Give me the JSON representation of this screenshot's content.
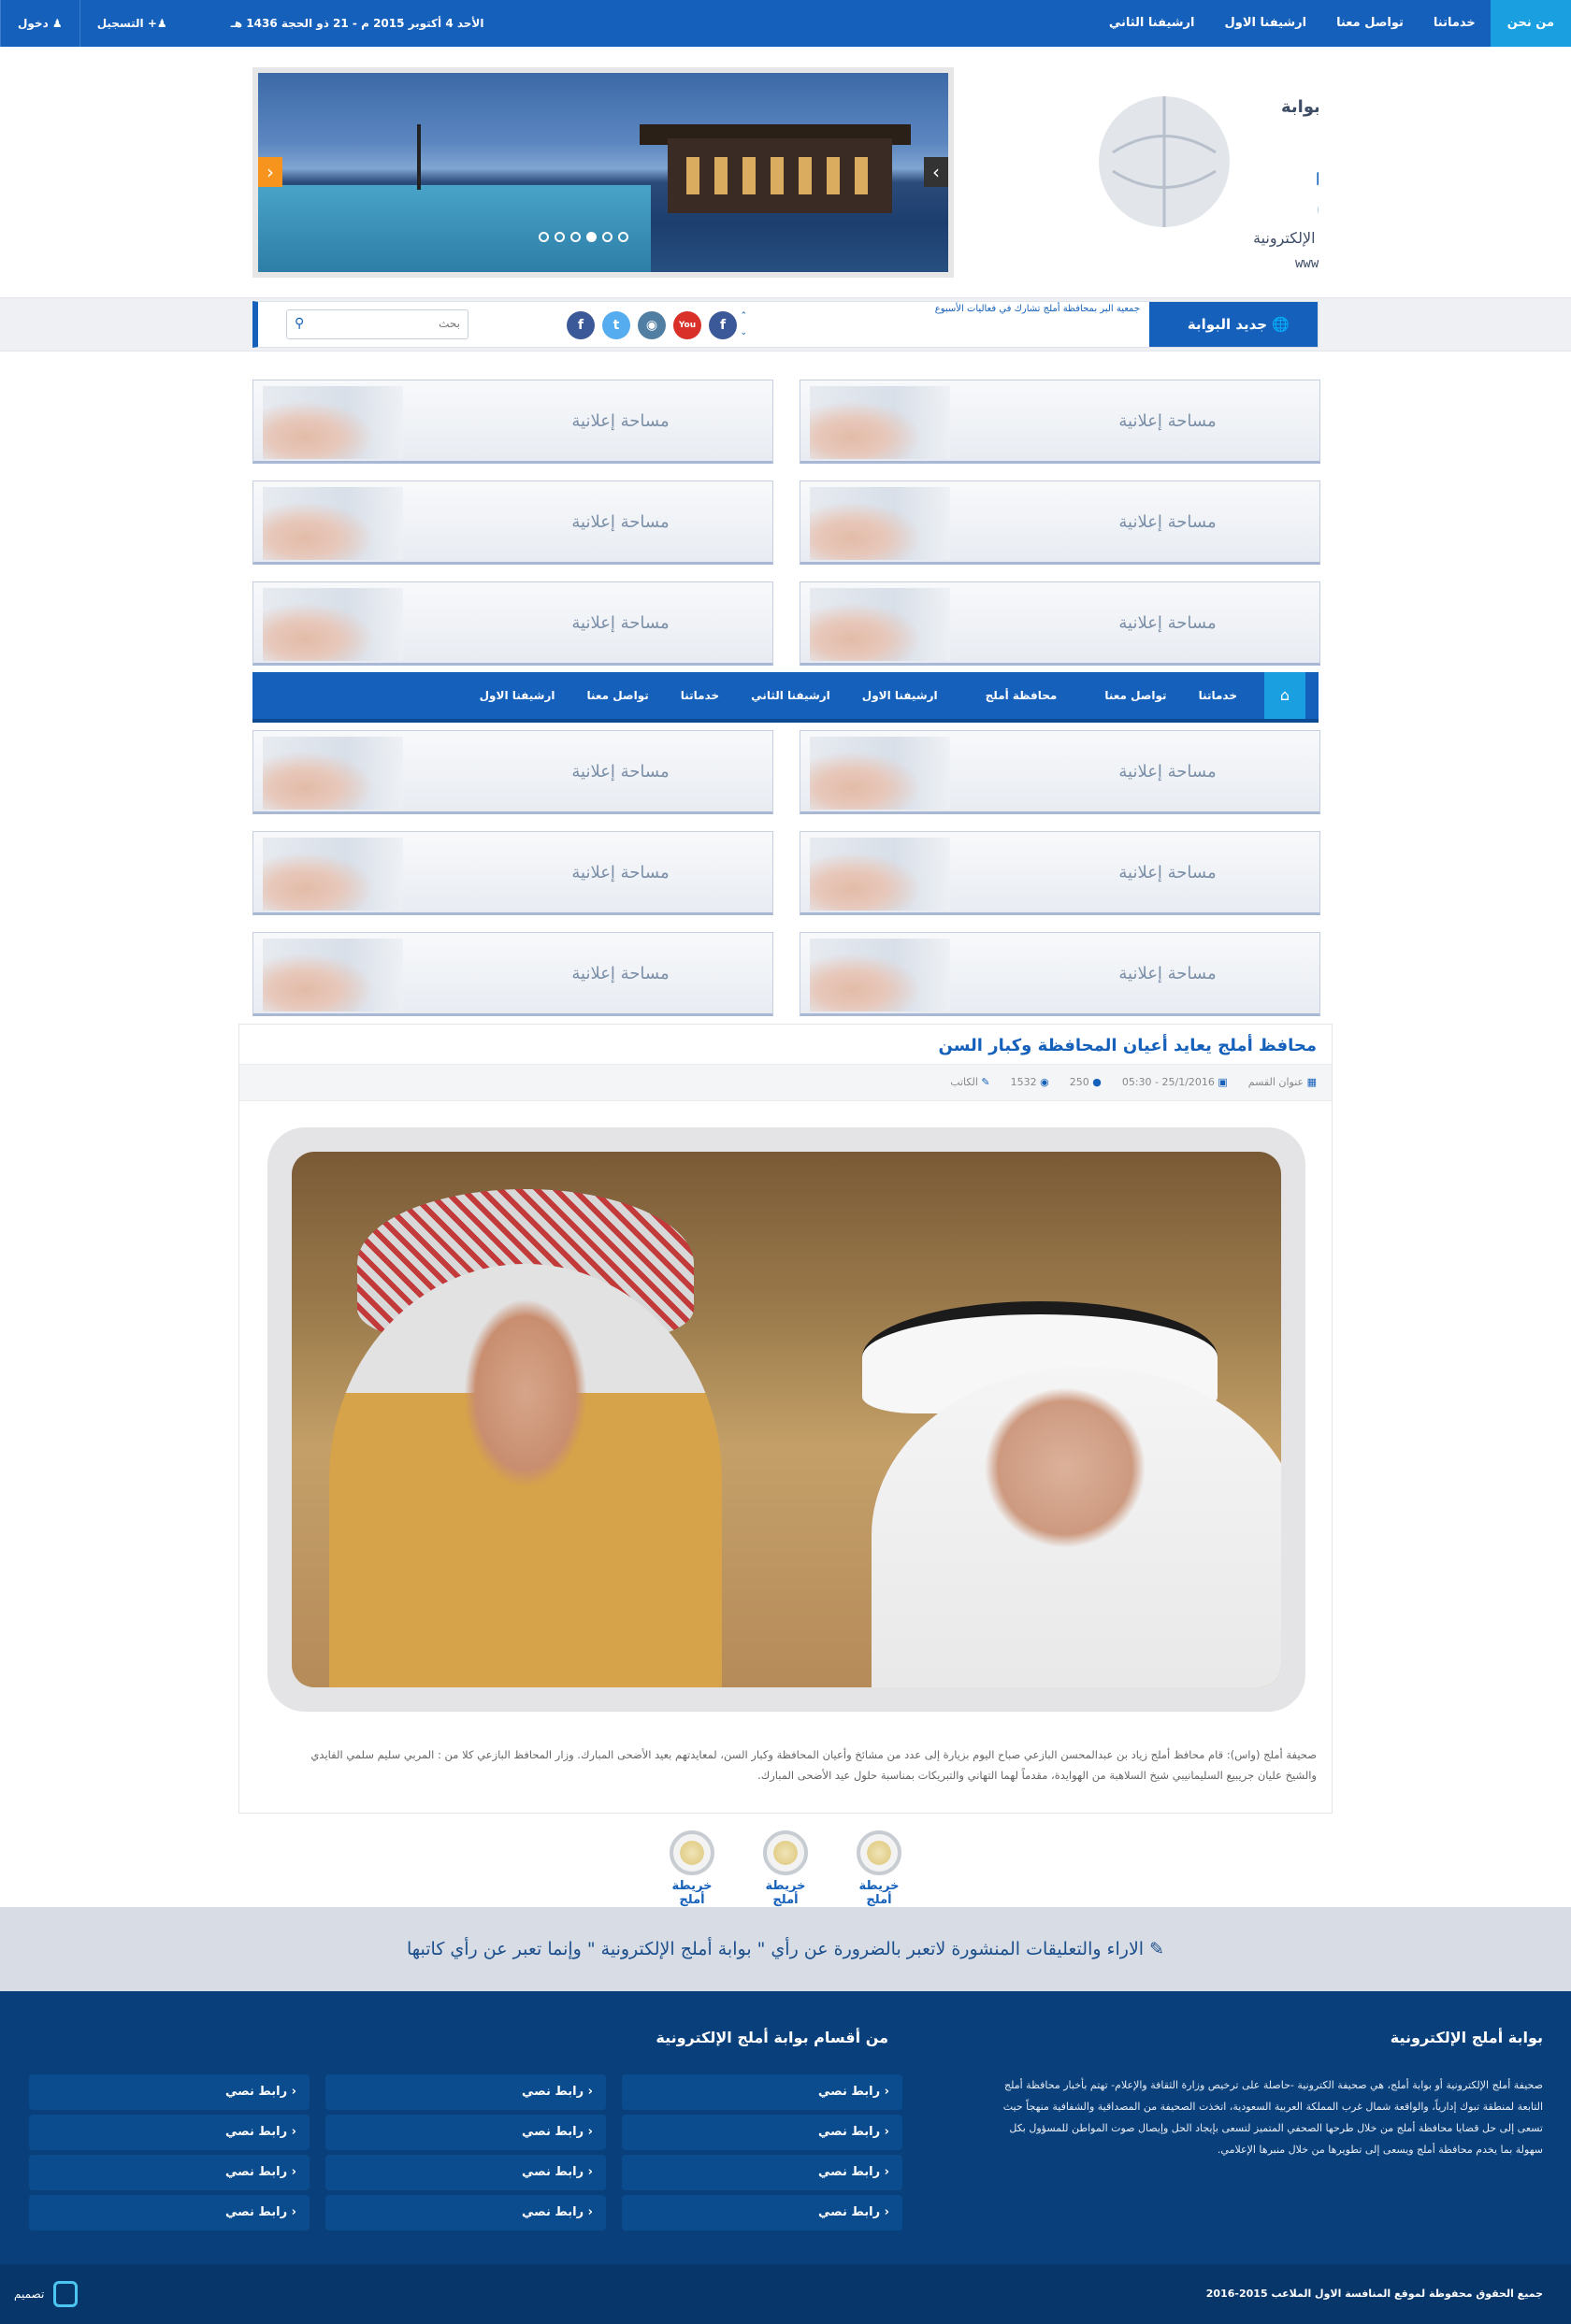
{
  "topbar": {
    "nav": [
      "من نحن",
      "خدماتنا",
      "تواصل معنا",
      "ارشيفنا الاول",
      "ارشيفنا الثاني"
    ],
    "login": "دخول",
    "register": "التسجيل",
    "date": "الأحد 4 أكتوبر 2015 م - 21 ذو الحجة 1436 هـ"
  },
  "logo": {
    "small": "بوابة",
    "main": "أملج",
    "sub": "الإلكترونية",
    "url": "www.umljgate.com"
  },
  "news": {
    "label": "جديد البوابة",
    "ticker": "جمعية البر بمحافظة أملج تشارك في فعاليات الأسبوع",
    "search_placeholder": "بحث"
  },
  "ads": {
    "label": "مساحة إعلانية"
  },
  "mainnav": {
    "items": [
      "خدماتنا",
      "تواصل معنا",
      "محافظة أملج",
      "ارشيفنا الاول",
      "ارشيفنا الثاني",
      "خدماتنا",
      "تواصل معنا",
      "ارشيفنا الاول"
    ]
  },
  "article": {
    "title": "محافظ أملج يعايد أعيان المحافظة وكبار السن",
    "section": "عنوان القسم",
    "datetime": "25/1/2016 - 05:30",
    "comments": "250",
    "views": "1532",
    "author": "الكاتب",
    "body": "صحيفة أملج (واس): قام محافظ أملج زياد بن عبدالمحسن البازعي صباح اليوم بزيارة إلى عدد من مشائخ وأعيان المحافظة وكبار السن، لمعايدتهم بعيد الأضحى المبارك. وزار المحافظ البازعي كلا من : المربي سليم سلمي الفايدي والشيخ عليان جريبيع السليمانيبي شيخ السلاهبة من الهوايدة، مقدماً لهما التهاني والتبريكات بمناسبة حلول عيد الأضحى المبارك."
  },
  "maps": [
    "خريطة أملج",
    "خريطة أملج",
    "خريطة أملج"
  ],
  "disclaimer": "الاراء والتعليقات المنشورة لاتعبر بالضرورة عن رأي \" بوابة أملج الإلكترونية \" وإنما تعبر عن رأي كاتبها",
  "footer": {
    "about_title": "بوابة أملج الإلكترونية",
    "about_text": "صحيفة أملج الإلكترونية أو بوابة أملج، هي صحيفة الكترونية -حاصلة على ترخيص وزارة الثقافة والإعلام- تهتم بأخبار محافظة أملج التابعة لمنطقة تبوك إدارياً، والواقعة شمال غرب المملكة العربية السعودية، اتخذت الصحيفة من المصداقية والشفافية منهجاً حيث تسعى إلى حل قضايا محافظة أملج من خلال طرحها الصحفي المتميز لتسعى بإيجاد الحل وإيصال صوت المواطن للمسؤول بكل سهولة بما يخدم محافظة أملج ويسعى إلى تطويرها من خلال منبرها الإعلامي.",
    "links_title": "من أقسام بوابة أملج الإلكترونية",
    "link_label": "رابط نصي",
    "copyright": "جميع الحقوق محفوظة لموقع المنافسة الاول الملاعب 2015-2016",
    "design": "تصميم"
  },
  "colors": {
    "primary": "#1460ba",
    "accent": "#1aa0e0",
    "footer": "#093f7a"
  }
}
